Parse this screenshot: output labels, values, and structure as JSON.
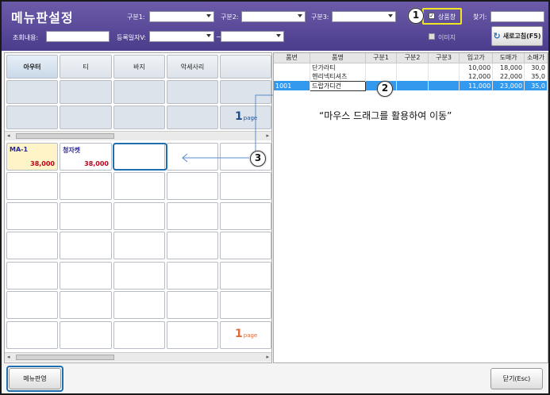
{
  "header": {
    "title": "메뉴판설정",
    "filters": [
      {
        "label": "구분1:",
        "value": ""
      },
      {
        "label": "구분2:",
        "value": ""
      },
      {
        "label": "구분3:",
        "value": ""
      }
    ],
    "search_label": "조회내용:",
    "search_value": "",
    "date_label": "등록일자V:",
    "date_from": "",
    "date_to": "",
    "date_separator": "~",
    "sales_checkbox_label": "상품창",
    "image_checkbox_label": "이미지",
    "find_label": "찾기:",
    "find_value": "",
    "refresh_label": "새로고침(F5)"
  },
  "categories": [
    "아우터",
    "티",
    "바지",
    "악세사리"
  ],
  "menu_items": [
    {
      "name": "MA-1",
      "price": "38,000"
    },
    {
      "name": "청자켓",
      "price": "38,000"
    }
  ],
  "category_page": {
    "number": "1",
    "label": "page"
  },
  "menu_page": {
    "number": "1",
    "label": "page"
  },
  "table": {
    "headers": [
      "품번",
      "품명",
      "구분1",
      "구분2",
      "구분3",
      "입고가",
      "도매가",
      "소매가"
    ],
    "rows": [
      {
        "code": "",
        "name": "단가라티",
        "c1": "",
        "c2": "",
        "c3": "",
        "in_price": "10,000",
        "wholesale": "18,000",
        "retail": "30,0"
      },
      {
        "code": "",
        "name": "헨리넥티셔츠",
        "c1": "",
        "c2": "",
        "c3": "",
        "in_price": "12,000",
        "wholesale": "22,000",
        "retail": "35,0"
      },
      {
        "code": "1001",
        "name": "드랍가디건",
        "c1": "",
        "c2": "",
        "c3": "",
        "in_price": "11,000",
        "wholesale": "23,000",
        "retail": "35,0"
      }
    ]
  },
  "annotation": {
    "text": "“마우스 드래그를 활용하여 이동”",
    "callouts": [
      "1",
      "2",
      "3"
    ]
  },
  "footer": {
    "apply_label": "메뉴판영",
    "close_label": "닫기(Esc)"
  },
  "colors": {
    "header": "#4b3c8c",
    "selected_row": "#3399ee",
    "price": "#c0001a",
    "highlight_box": "#f2e620",
    "focus_box": "#1f6fb0"
  }
}
